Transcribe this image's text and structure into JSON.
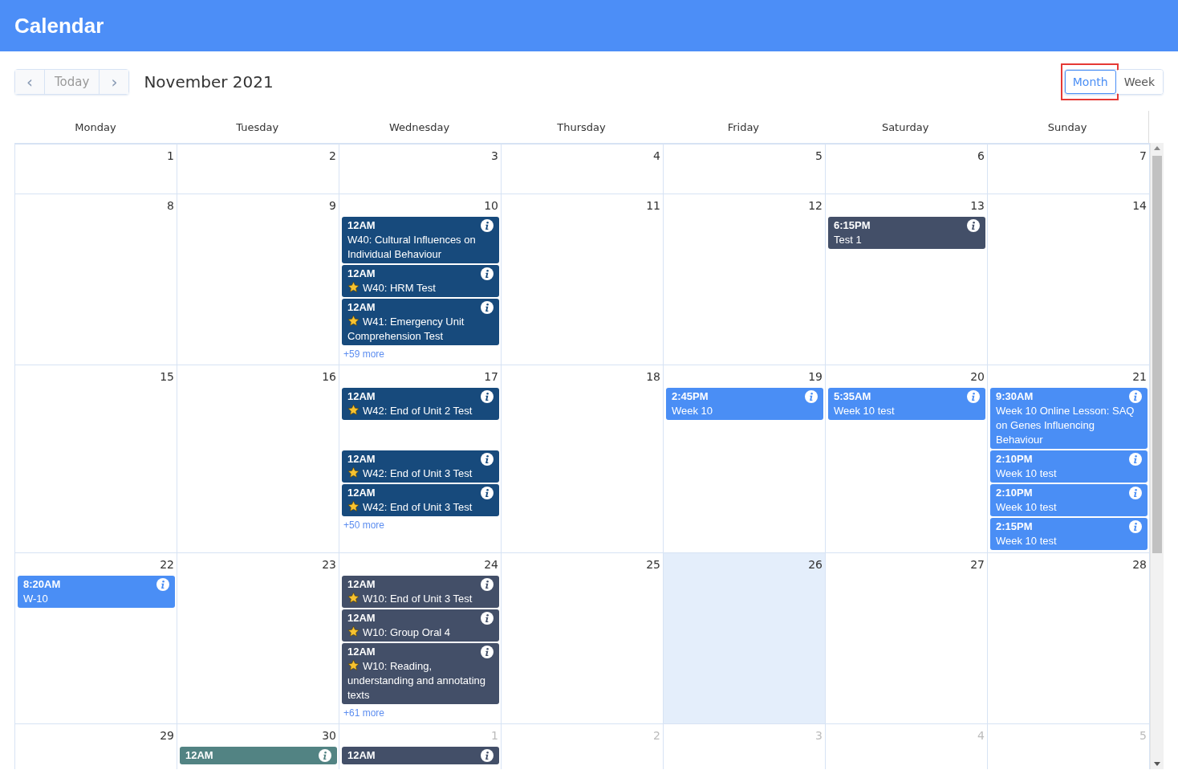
{
  "app_bar": {
    "title": "Calendar"
  },
  "toolbar": {
    "prev": "‹",
    "today": "Today",
    "next": "›",
    "period": "November 2021",
    "views": [
      {
        "label": "Month",
        "selected": true,
        "highlighted": true
      },
      {
        "label": "Week",
        "selected": false,
        "highlighted": false
      }
    ]
  },
  "weekdays": [
    "Monday",
    "Tuesday",
    "Wednesday",
    "Thursday",
    "Friday",
    "Saturday",
    "Sunday"
  ],
  "weeks": [
    {
      "days": [
        {
          "date": "1",
          "muted": false,
          "today": false
        },
        {
          "date": "2",
          "muted": false,
          "today": false
        },
        {
          "date": "3",
          "muted": false,
          "today": false
        },
        {
          "date": "4",
          "muted": false,
          "today": false
        },
        {
          "date": "5",
          "muted": false,
          "today": false
        },
        {
          "date": "6",
          "muted": false,
          "today": false
        },
        {
          "date": "7",
          "muted": false,
          "today": false
        }
      ]
    },
    {
      "days": [
        {
          "date": "8",
          "muted": false,
          "today": false
        },
        {
          "date": "9",
          "muted": false,
          "today": false
        },
        {
          "date": "10",
          "muted": false,
          "today": false,
          "events": [
            {
              "time": "12AM",
              "title": "W40: Cultural Influences on Individual Behaviour",
              "starred": false,
              "color": "#174a7c"
            },
            {
              "time": "12AM",
              "title": "W40: HRM Test",
              "starred": true,
              "color": "#174a7c"
            },
            {
              "time": "12AM",
              "title": "W41: Emergency Unit Comprehension Test",
              "starred": true,
              "color": "#174a7c"
            }
          ],
          "more": "+59 more"
        },
        {
          "date": "11",
          "muted": false,
          "today": false
        },
        {
          "date": "12",
          "muted": false,
          "today": false
        },
        {
          "date": "13",
          "muted": false,
          "today": false,
          "events": [
            {
              "time": "6:15PM",
              "title": "Test 1",
              "starred": false,
              "color": "#434f68"
            }
          ]
        },
        {
          "date": "14",
          "muted": false,
          "today": false
        }
      ]
    },
    {
      "days": [
        {
          "date": "15",
          "muted": false,
          "today": false
        },
        {
          "date": "16",
          "muted": false,
          "today": false
        },
        {
          "date": "17",
          "muted": false,
          "today": false,
          "events": [
            {
              "time": "12AM",
              "title": "W42: End of Unit 2 Test",
              "starred": true,
              "color": "#174a7c"
            },
            {
              "kind": "gap"
            },
            {
              "time": "12AM",
              "title": "W42: End of Unit 3 Test",
              "starred": true,
              "color": "#174a7c"
            },
            {
              "time": "12AM",
              "title": "W42: End of Unit 3 Test",
              "starred": true,
              "color": "#174a7c"
            }
          ],
          "more": "+50 more"
        },
        {
          "date": "18",
          "muted": false,
          "today": false
        },
        {
          "date": "19",
          "muted": false,
          "today": false,
          "events": [
            {
              "time": "2:45PM",
              "title": "Week 10",
              "starred": false,
              "color": "#4a8ef5"
            }
          ]
        },
        {
          "date": "20",
          "muted": false,
          "today": false,
          "events": [
            {
              "time": "5:35AM",
              "title": "Week 10 test",
              "starred": false,
              "color": "#4a8ef5"
            }
          ]
        },
        {
          "date": "21",
          "muted": false,
          "today": false,
          "events": [
            {
              "time": "9:30AM",
              "title": "Week 10 Online Lesson: SAQ on Genes Influencing Behaviour",
              "starred": false,
              "color": "#4a8ef5"
            },
            {
              "time": "2:10PM",
              "title": "Week 10 test",
              "starred": false,
              "color": "#4a8ef5"
            },
            {
              "time": "2:10PM",
              "title": "Week 10 test",
              "starred": false,
              "color": "#4a8ef5"
            },
            {
              "time": "2:15PM",
              "title": "Week 10 test",
              "starred": false,
              "color": "#4a8ef5"
            }
          ]
        }
      ]
    },
    {
      "days": [
        {
          "date": "22",
          "muted": false,
          "today": false,
          "events": [
            {
              "time": "8:20AM",
              "title": "W-10",
              "starred": false,
              "color": "#4a8ef5"
            }
          ]
        },
        {
          "date": "23",
          "muted": false,
          "today": false
        },
        {
          "date": "24",
          "muted": false,
          "today": false,
          "events": [
            {
              "time": "12AM",
              "title": "W10: End of Unit 3 Test",
              "starred": true,
              "color": "#434f68"
            },
            {
              "time": "12AM",
              "title": "W10: Group Oral 4",
              "starred": true,
              "color": "#434f68"
            },
            {
              "time": "12AM",
              "title": "W10: Reading, understanding and annotating texts",
              "starred": true,
              "color": "#434f68"
            }
          ],
          "more": "+61 more"
        },
        {
          "date": "25",
          "muted": false,
          "today": false
        },
        {
          "date": "26",
          "muted": false,
          "today": true
        },
        {
          "date": "27",
          "muted": false,
          "today": false
        },
        {
          "date": "28",
          "muted": false,
          "today": false
        }
      ]
    },
    {
      "days": [
        {
          "date": "29",
          "muted": false,
          "today": false
        },
        {
          "date": "30",
          "muted": false,
          "today": false,
          "events": [
            {
              "time": "12AM",
              "starred": false,
              "color": "#528383"
            }
          ]
        },
        {
          "date": "1",
          "muted": true,
          "today": false,
          "events": [
            {
              "time": "12AM",
              "starred": false,
              "color": "#434f68"
            }
          ]
        },
        {
          "date": "2",
          "muted": true,
          "today": false
        },
        {
          "date": "3",
          "muted": true,
          "today": false
        },
        {
          "date": "4",
          "muted": true,
          "today": false
        },
        {
          "date": "5",
          "muted": true,
          "today": false
        }
      ]
    }
  ]
}
